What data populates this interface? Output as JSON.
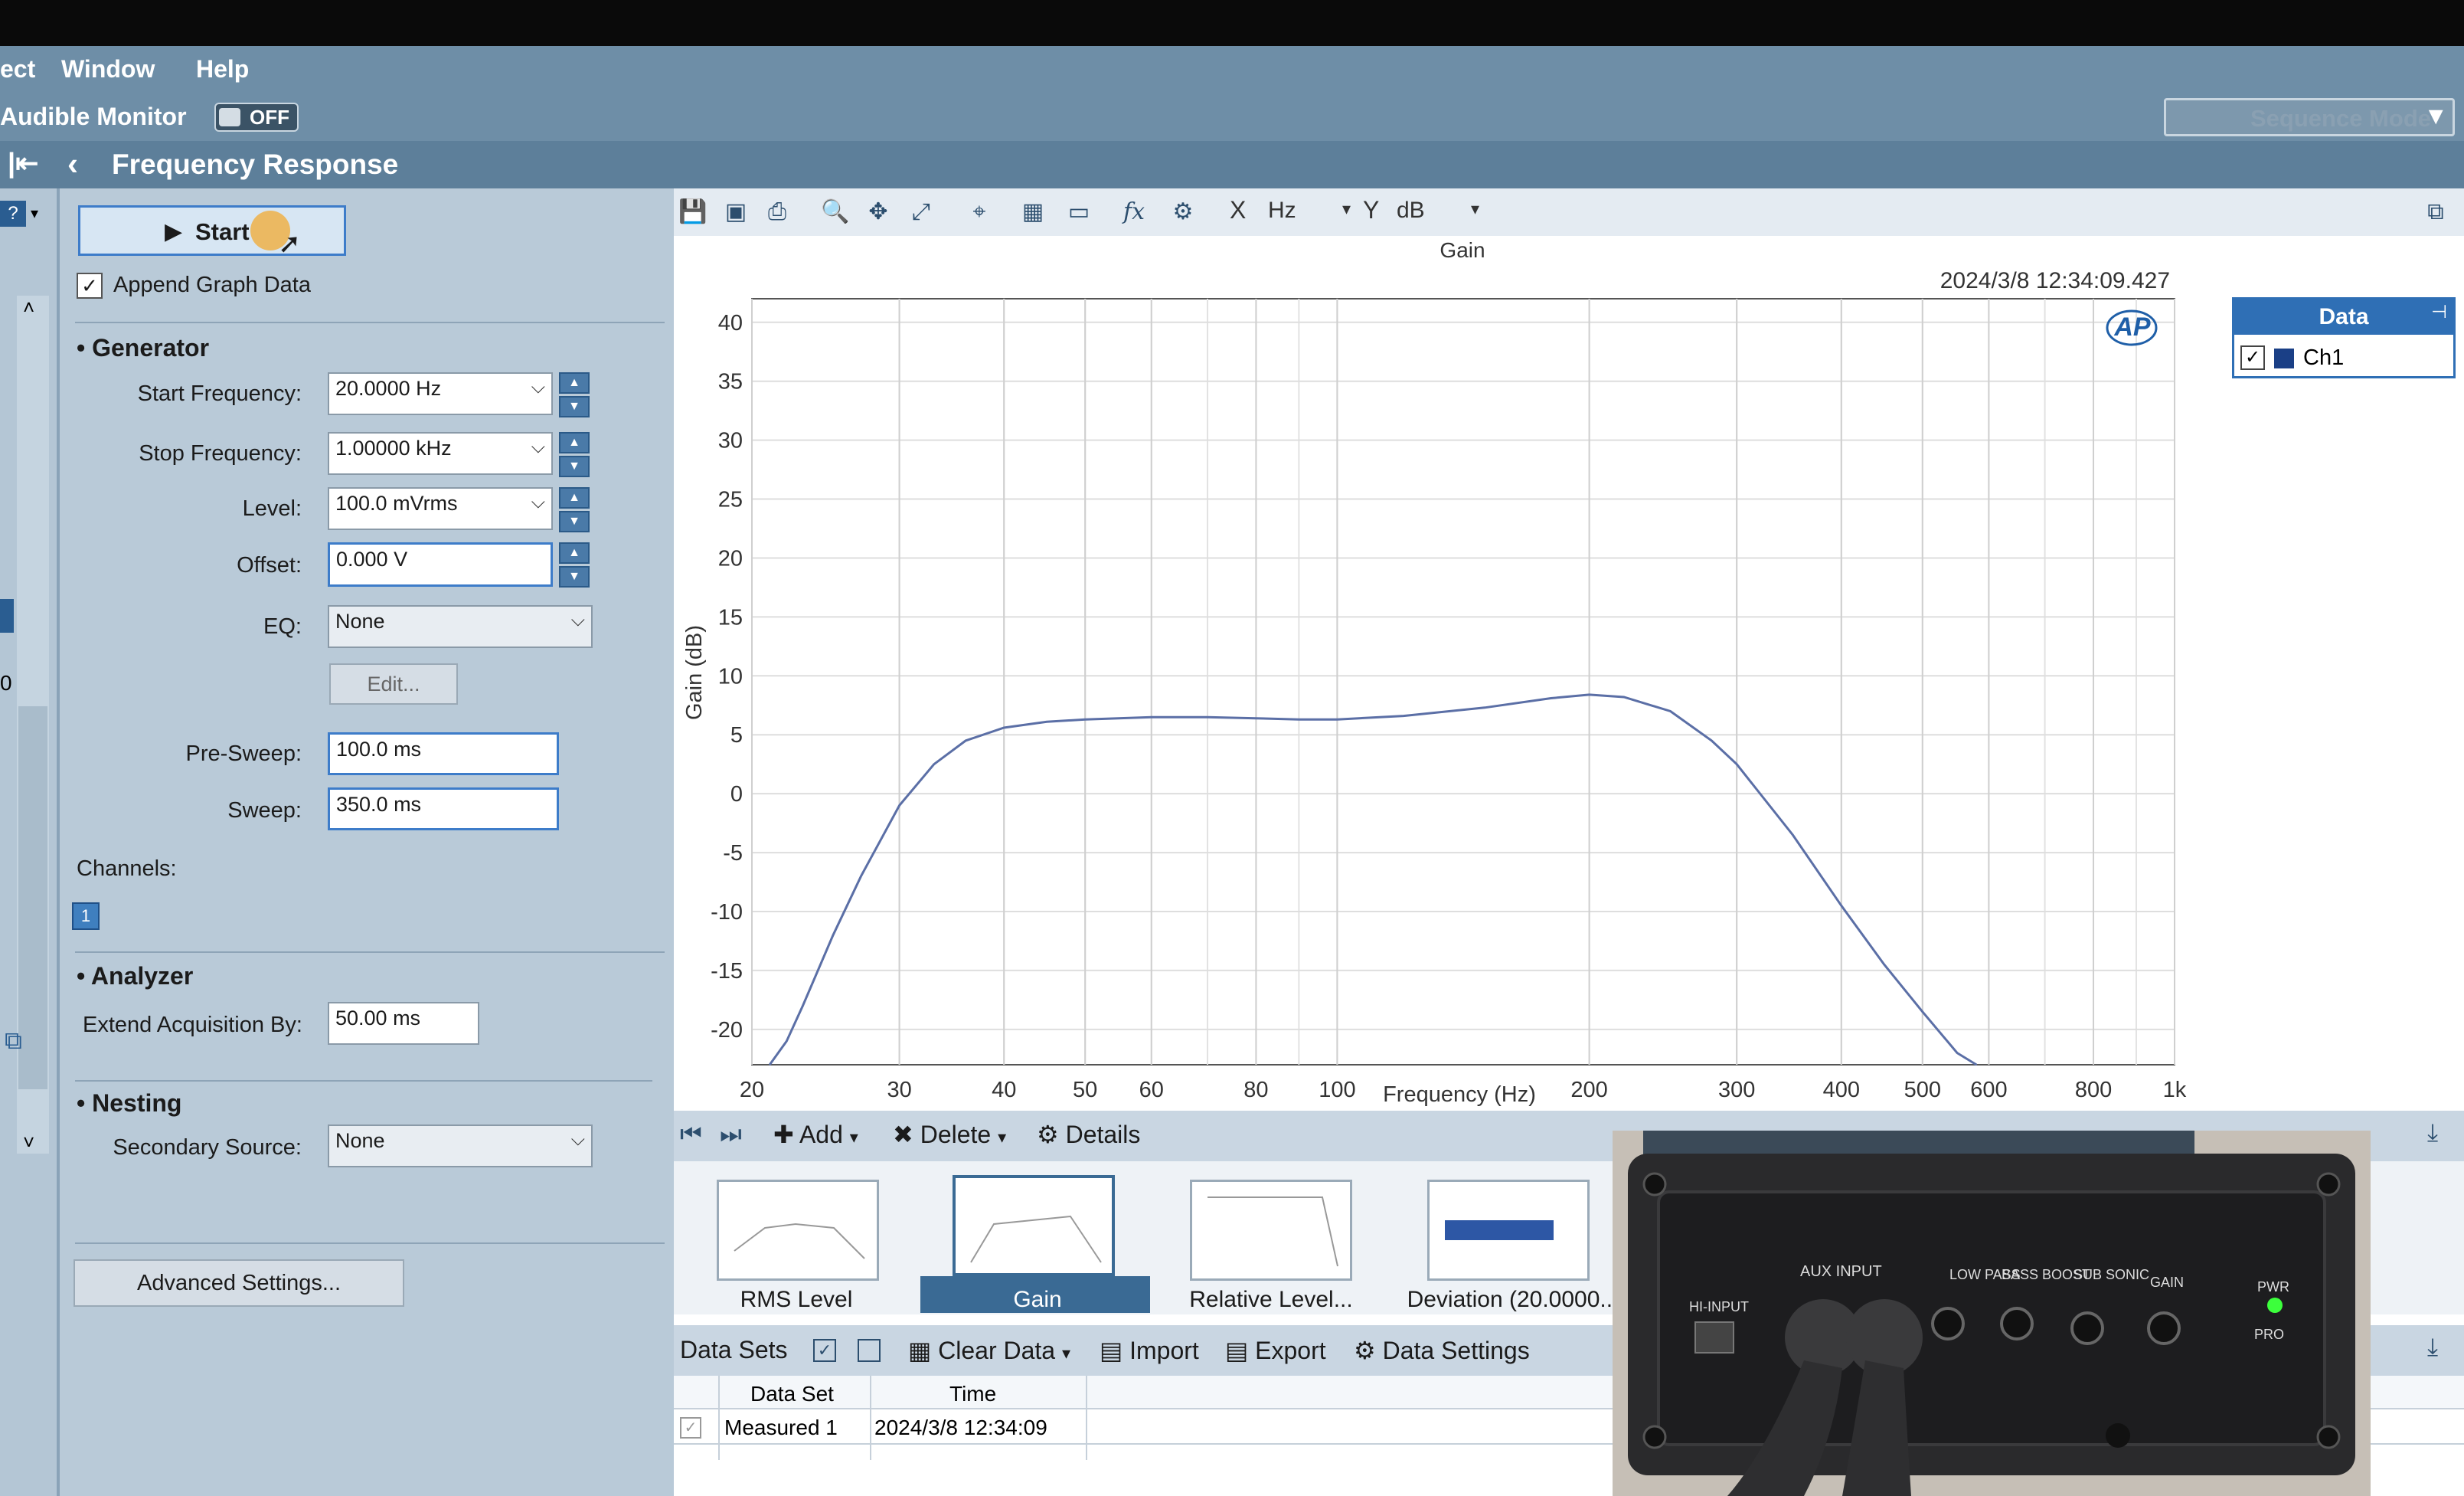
{
  "menu": {
    "items": [
      "ect",
      "Window",
      "Help"
    ]
  },
  "monitor": {
    "label": "Audible Monitor",
    "toggle": "OFF",
    "sequence_mode": "Sequence Mode"
  },
  "title": "Frequency Response",
  "controls": {
    "start": "Start",
    "append_graph": "Append Graph Data",
    "generator_header": "Generator",
    "start_freq_label": "Start Frequency:",
    "start_freq": "20.0000 Hz",
    "stop_freq_label": "Stop Frequency:",
    "stop_freq": "1.00000 kHz",
    "level_label": "Level:",
    "level": "100.0 mVrms",
    "offset_label": "Offset:",
    "offset": "0.000 V",
    "eq_label": "EQ:",
    "eq": "None",
    "edit": "Edit...",
    "presweep_label": "Pre-Sweep:",
    "presweep": "100.0 ms",
    "sweep_label": "Sweep:",
    "sweep": "350.0 ms",
    "channels_label": "Channels:",
    "channel_1": "1",
    "analyzer_header": "Analyzer",
    "extend_label": "Extend Acquisition By:",
    "extend": "50.00 ms",
    "nesting_header": "Nesting",
    "secondary_label": "Secondary Source:",
    "secondary": "None",
    "advanced": "Advanced Settings..."
  },
  "left_strip": {
    "edge_a": "0"
  },
  "graph_toolbar": {
    "x_label": "X",
    "x_unit": "Hz",
    "y_label": "Y",
    "y_unit": "dB"
  },
  "legend": {
    "header": "Data",
    "item": "Ch1"
  },
  "nav": {
    "add": "Add",
    "delete": "Delete",
    "details": "Details"
  },
  "thumbs": [
    "RMS Level",
    "Gain",
    "Relative Level...",
    "Deviation (20.0000..."
  ],
  "datasets": {
    "label": "Data Sets",
    "clear": "Clear Data",
    "import": "Import",
    "export": "Export",
    "settings": "Data Settings",
    "col_dataset": "Data Set",
    "col_time": "Time",
    "rows": [
      {
        "name": "Measured 1",
        "time": "2024/3/8 12:34:09"
      }
    ]
  },
  "device": {
    "hi_input": "HI-INPUT",
    "aux_input": "AUX INPUT",
    "low_pass": "LOW PASS",
    "bass_boost": "BASS BOOST",
    "sub_sonic": "SUB SONIC",
    "gain": "GAIN",
    "pwr": "PWR",
    "pro": "PRO"
  },
  "colors": {
    "series": "#5b6fa6",
    "accent": "#2f6fb5",
    "titlebar": "#5d7f9a"
  },
  "chart_data": {
    "type": "line",
    "title": "Gain",
    "timestamp": "2024/3/8 12:34:09.427",
    "logo": "AP",
    "xlabel": "Frequency (Hz)",
    "ylabel": "Gain (dB)",
    "x_scale": "log",
    "xlim": [
      20,
      1000
    ],
    "ylim": [
      -23,
      42
    ],
    "x_ticks": [
      20,
      30,
      40,
      50,
      60,
      80,
      100,
      200,
      300,
      400,
      500,
      600,
      800,
      1000
    ],
    "x_tick_labels": [
      "20",
      "30",
      "40",
      "50",
      "60",
      "80",
      "100",
      "200",
      "300",
      "400",
      "500",
      "600",
      "800",
      "1k"
    ],
    "y_ticks": [
      40,
      35,
      30,
      25,
      20,
      15,
      10,
      5,
      0,
      -5,
      -10,
      -15,
      -20
    ],
    "grid": true,
    "legend_placement": "right",
    "series": [
      {
        "name": "Ch1",
        "x": [
          21,
          22,
          23,
          25,
          27,
          30,
          33,
          36,
          40,
          45,
          50,
          60,
          70,
          80,
          90,
          100,
          120,
          150,
          180,
          200,
          220,
          250,
          280,
          300,
          350,
          400,
          450,
          500,
          550,
          580
        ],
        "y": [
          -23,
          -21,
          -18,
          -12,
          -7,
          -1,
          2.5,
          4.5,
          5.6,
          6.1,
          6.3,
          6.5,
          6.5,
          6.4,
          6.3,
          6.3,
          6.6,
          7.3,
          8.1,
          8.4,
          8.2,
          7,
          4.5,
          2.5,
          -3.5,
          -9.5,
          -14.5,
          -18.5,
          -22,
          -23
        ]
      }
    ]
  }
}
